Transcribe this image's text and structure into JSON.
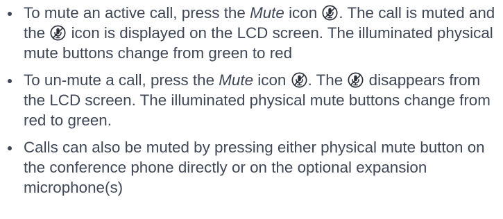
{
  "icons": {
    "mute": "mute-microphone-icon"
  },
  "colors": {
    "text": "#3f4756",
    "icon": "#2a2f3a"
  },
  "bullets": [
    {
      "a": "To mute an active call, press the ",
      "em": "Mute",
      "b": " icon ",
      "c": ".  The call is muted and the ",
      "d": " icon is displayed on the LCD screen.  The illuminated physical mute buttons change from green to red"
    },
    {
      "a": "To un-mute a call, press the ",
      "em": "Mute",
      "b": " icon ",
      "c": ".  The ",
      "d": " disappears from the LCD screen.  The illuminated physical mute buttons change from red to green."
    },
    {
      "text": "Calls can also be muted by pressing either physical mute button on the conference phone directly or on the optional expansion microphone(s)"
    }
  ]
}
